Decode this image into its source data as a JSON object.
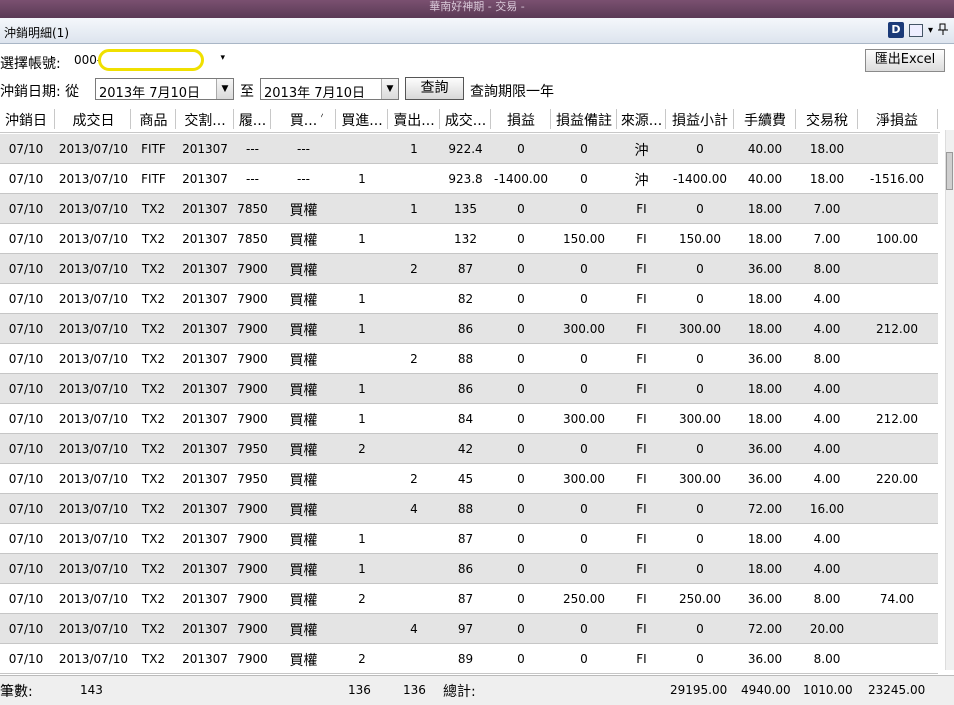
{
  "app_title": "華南好神期 - 交易 -",
  "window": {
    "title": "沖銷明細(1)"
  },
  "toolbar": {
    "d_label": "D",
    "arrow": "▾",
    "pin": "ᵖ"
  },
  "account": {
    "label": "選擇帳號:",
    "prefix": "000-"
  },
  "export_button": "匯出Excel",
  "date_filter": {
    "label": "沖銷日期: 從",
    "from": "2013年  7月10日",
    "to_label": "至",
    "to": "2013年  7月10日",
    "query_button": "查詢",
    "note": "查詢期限一年"
  },
  "columns": [
    "沖銷日",
    "成交日",
    "商品",
    "交割...",
    "履...",
    "買...",
    "買進...",
    "賣出...",
    "成交...",
    "損益",
    "損益備註",
    "來源...",
    "損益小計",
    "手續費",
    "交易稅",
    "淨損益"
  ],
  "rows": [
    [
      "07/10",
      "2013/07/10",
      "FITF",
      "201307",
      "---",
      "---",
      "",
      "1",
      "922.4",
      "0",
      "0",
      "沖",
      "0",
      "40.00",
      "18.00",
      ""
    ],
    [
      "07/10",
      "2013/07/10",
      "FITF",
      "201307",
      "---",
      "---",
      "1",
      "",
      "923.8",
      "-1400.00",
      "0",
      "沖",
      "-1400.00",
      "40.00",
      "18.00",
      "-1516.00"
    ],
    [
      "07/10",
      "2013/07/10",
      "TX2",
      "201307",
      "7850",
      "買權",
      "",
      "1",
      "135",
      "0",
      "0",
      "FI",
      "0",
      "18.00",
      "7.00",
      ""
    ],
    [
      "07/10",
      "2013/07/10",
      "TX2",
      "201307",
      "7850",
      "買權",
      "1",
      "",
      "132",
      "0",
      "150.00",
      "FI",
      "150.00",
      "18.00",
      "7.00",
      "100.00"
    ],
    [
      "07/10",
      "2013/07/10",
      "TX2",
      "201307",
      "7900",
      "買權",
      "",
      "2",
      "87",
      "0",
      "0",
      "FI",
      "0",
      "36.00",
      "8.00",
      ""
    ],
    [
      "07/10",
      "2013/07/10",
      "TX2",
      "201307",
      "7900",
      "買權",
      "1",
      "",
      "82",
      "0",
      "0",
      "FI",
      "0",
      "18.00",
      "4.00",
      ""
    ],
    [
      "07/10",
      "2013/07/10",
      "TX2",
      "201307",
      "7900",
      "買權",
      "1",
      "",
      "86",
      "0",
      "300.00",
      "FI",
      "300.00",
      "18.00",
      "4.00",
      "212.00"
    ],
    [
      "07/10",
      "2013/07/10",
      "TX2",
      "201307",
      "7900",
      "買權",
      "",
      "2",
      "88",
      "0",
      "0",
      "FI",
      "0",
      "36.00",
      "8.00",
      ""
    ],
    [
      "07/10",
      "2013/07/10",
      "TX2",
      "201307",
      "7900",
      "買權",
      "1",
      "",
      "86",
      "0",
      "0",
      "FI",
      "0",
      "18.00",
      "4.00",
      ""
    ],
    [
      "07/10",
      "2013/07/10",
      "TX2",
      "201307",
      "7900",
      "買權",
      "1",
      "",
      "84",
      "0",
      "300.00",
      "FI",
      "300.00",
      "18.00",
      "4.00",
      "212.00"
    ],
    [
      "07/10",
      "2013/07/10",
      "TX2",
      "201307",
      "7950",
      "買權",
      "2",
      "",
      "42",
      "0",
      "0",
      "FI",
      "0",
      "36.00",
      "4.00",
      ""
    ],
    [
      "07/10",
      "2013/07/10",
      "TX2",
      "201307",
      "7950",
      "買權",
      "",
      "2",
      "45",
      "0",
      "300.00",
      "FI",
      "300.00",
      "36.00",
      "4.00",
      "220.00"
    ],
    [
      "07/10",
      "2013/07/10",
      "TX2",
      "201307",
      "7900",
      "買權",
      "",
      "4",
      "88",
      "0",
      "0",
      "FI",
      "0",
      "72.00",
      "16.00",
      ""
    ],
    [
      "07/10",
      "2013/07/10",
      "TX2",
      "201307",
      "7900",
      "買權",
      "1",
      "",
      "87",
      "0",
      "0",
      "FI",
      "0",
      "18.00",
      "4.00",
      ""
    ],
    [
      "07/10",
      "2013/07/10",
      "TX2",
      "201307",
      "7900",
      "買權",
      "1",
      "",
      "86",
      "0",
      "0",
      "FI",
      "0",
      "18.00",
      "4.00",
      ""
    ],
    [
      "07/10",
      "2013/07/10",
      "TX2",
      "201307",
      "7900",
      "買權",
      "2",
      "",
      "87",
      "0",
      "250.00",
      "FI",
      "250.00",
      "36.00",
      "8.00",
      "74.00"
    ],
    [
      "07/10",
      "2013/07/10",
      "TX2",
      "201307",
      "7900",
      "買權",
      "",
      "4",
      "97",
      "0",
      "0",
      "FI",
      "0",
      "72.00",
      "20.00",
      ""
    ],
    [
      "07/10",
      "2013/07/10",
      "TX2",
      "201307",
      "7900",
      "買權",
      "2",
      "",
      "89",
      "0",
      "0",
      "FI",
      "0",
      "36.00",
      "8.00",
      ""
    ]
  ],
  "footer": {
    "count_label": "筆數:",
    "count": "143",
    "buy_total": "136",
    "sell_total": "136",
    "total_label": "總計:",
    "pl_subtotal": "29195.00",
    "fee": "4940.00",
    "tax": "1010.00",
    "net": "23245.00"
  }
}
